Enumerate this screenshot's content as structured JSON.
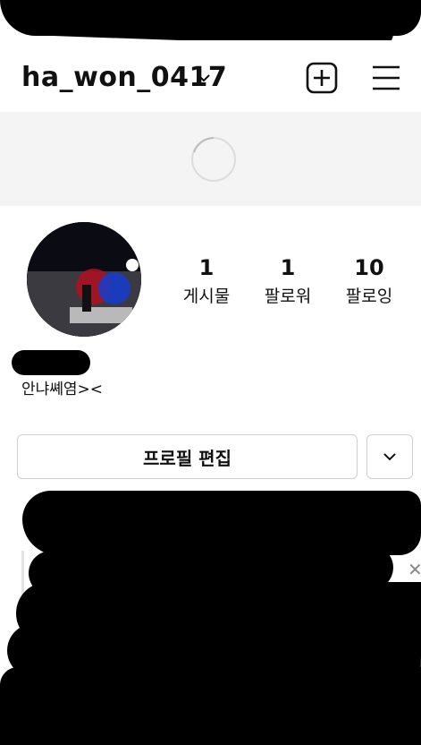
{
  "header": {
    "username": "ha_won_0417",
    "username_dropdown_icon": "chevron-down-icon",
    "new_post_icon": "plus-square-icon",
    "menu_icon": "hamburger-menu-icon"
  },
  "profile": {
    "stats": [
      {
        "count": "1",
        "label": "게시물"
      },
      {
        "count": "1",
        "label": "팔로워"
      },
      {
        "count": "10",
        "label": "팔로잉"
      }
    ],
    "bio": "안냐쎼염><"
  },
  "actions": {
    "edit_profile_label": "프로필 편집",
    "more_icon": "chevron-down-icon"
  },
  "suggestions": {
    "close_icon": "close-icon"
  }
}
